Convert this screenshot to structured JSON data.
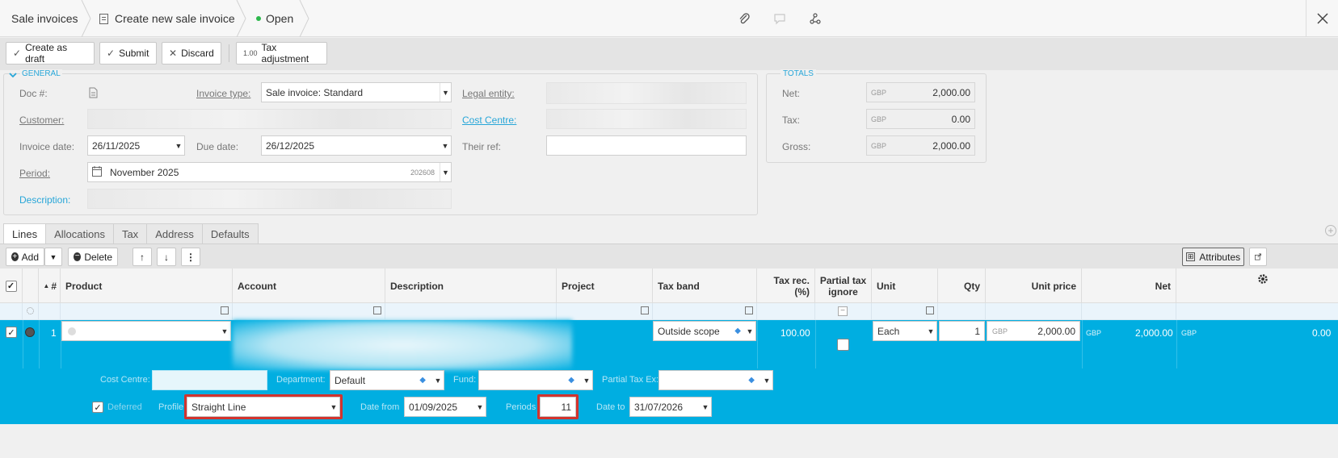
{
  "breadcrumb": {
    "items": [
      "Sale invoices",
      "Create new sale invoice"
    ],
    "status": "Open",
    "status_color": "#2db84c"
  },
  "toolbar": {
    "create_draft": "Create as draft",
    "submit": "Submit",
    "discard": "Discard",
    "tax_adjustment": "Tax adjustment"
  },
  "general": {
    "section_title": "GENERAL",
    "doc_label": "Doc #:",
    "invoice_type_label": "Invoice type:",
    "invoice_type_value": "Sale invoice: Standard",
    "legal_entity_label": "Legal entity:",
    "customer_label": "Customer:",
    "cost_centre_label": "Cost Centre:",
    "invoice_date_label": "Invoice date:",
    "invoice_date_value": "26/11/2025",
    "due_date_label": "Due date:",
    "due_date_value": "26/12/2025",
    "their_ref_label": "Their ref:",
    "period_label": "Period:",
    "period_value": "November 2025",
    "period_code": "202608",
    "description_label": "Description:"
  },
  "totals": {
    "section_title": "TOTALS",
    "net_label": "Net:",
    "net_currency": "GBP",
    "net_value": "2,000.00",
    "tax_label": "Tax:",
    "tax_currency": "GBP",
    "tax_value": "0.00",
    "gross_label": "Gross:",
    "gross_currency": "GBP",
    "gross_value": "2,000.00"
  },
  "tabs": [
    "Lines",
    "Allocations",
    "Tax",
    "Address",
    "Defaults"
  ],
  "grid_toolbar": {
    "add": "Add",
    "delete": "Delete",
    "attributes": "Attributes"
  },
  "columns": {
    "num": "#",
    "product": "Product",
    "account": "Account",
    "description": "Description",
    "project": "Project",
    "tax_band": "Tax band",
    "tax_rec": "Tax rec. (%)",
    "partial_tax_ignore": "Partial tax ignore",
    "unit": "Unit",
    "qty": "Qty",
    "unit_price": "Unit price",
    "net": "Net"
  },
  "line": {
    "num": "1",
    "tax_band": "Outside scope",
    "tax_rec": "100.00",
    "unit": "Each",
    "qty": "1",
    "unit_price_currency": "GBP",
    "unit_price": "2,000.00",
    "net_currency": "GBP",
    "net": "2,000.00",
    "extra_currency": "GBP",
    "extra_value": "0.00"
  },
  "line_detail": {
    "cost_centre_label": "Cost Centre:",
    "department_label": "Department:",
    "department_value": "Default",
    "fund_label": "Fund:",
    "partial_tax_label": "Partial Tax Ex:",
    "deferred_label": "Deferred",
    "profile_label": "Profile",
    "profile_value": "Straight Line",
    "date_from_label": "Date from",
    "date_from_value": "01/09/2025",
    "periods_label": "Periods",
    "periods_value": "11",
    "date_to_label": "Date to",
    "date_to_value": "31/07/2026"
  },
  "colors": {
    "accent": "#27a6d8",
    "selected_row": "#00aee1",
    "highlight": "#d2332e"
  }
}
